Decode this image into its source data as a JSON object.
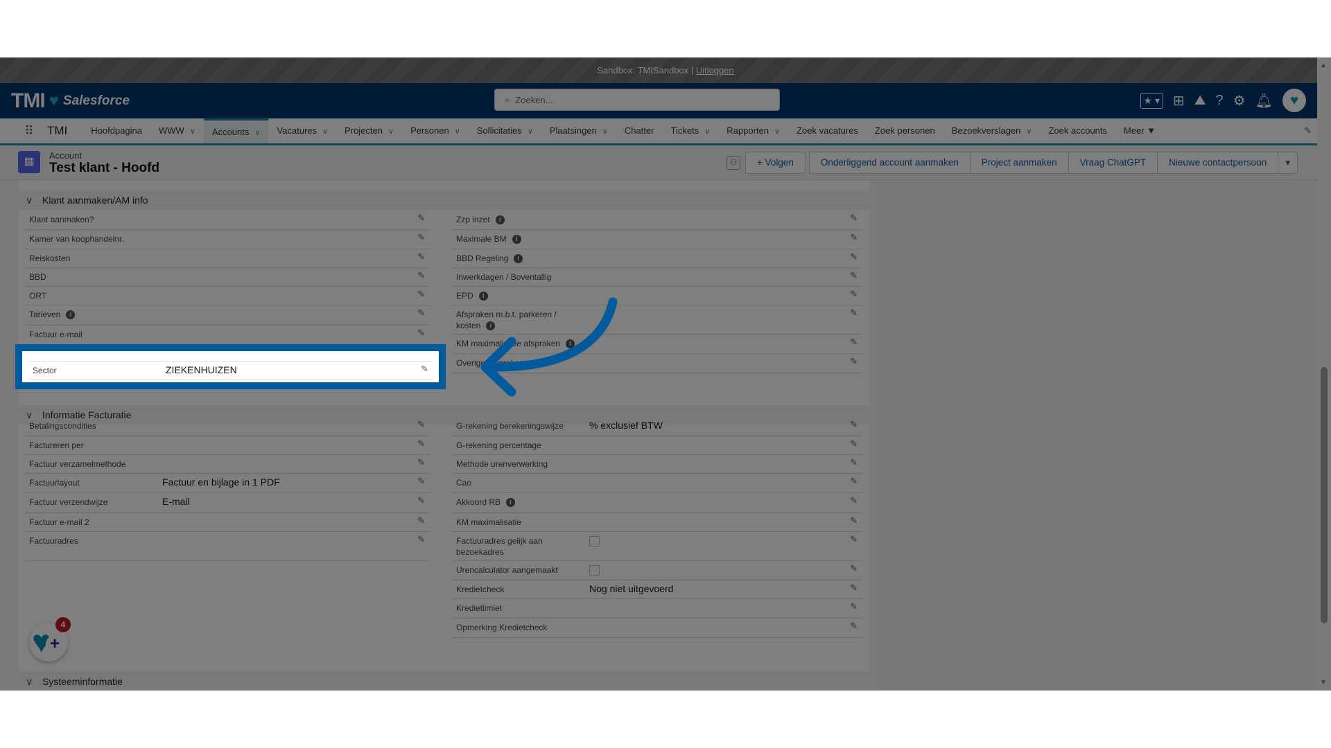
{
  "sandbox": {
    "text": "Sandbox: TMISandbox |",
    "logout": "Uitloggen"
  },
  "header": {
    "logo_text": "TMI",
    "logo_product": "Salesforce",
    "search_placeholder": "Zoeken..."
  },
  "nav": {
    "app_name": "TMI",
    "items": [
      {
        "label": "Hoofdpagina",
        "dropdown": false
      },
      {
        "label": "WWW",
        "dropdown": true
      },
      {
        "label": "Accounts",
        "dropdown": true,
        "selected": true
      },
      {
        "label": "Vacatures",
        "dropdown": true
      },
      {
        "label": "Projecten",
        "dropdown": true
      },
      {
        "label": "Personen",
        "dropdown": true
      },
      {
        "label": "Sollicitaties",
        "dropdown": true
      },
      {
        "label": "Plaatsingen",
        "dropdown": true
      },
      {
        "label": "Chatter",
        "dropdown": false
      },
      {
        "label": "Tickets",
        "dropdown": true
      },
      {
        "label": "Rapporten",
        "dropdown": true
      },
      {
        "label": "Zoek vacatures",
        "dropdown": false
      },
      {
        "label": "Zoek personen",
        "dropdown": false
      },
      {
        "label": "Bezoekverslagen",
        "dropdown": true
      },
      {
        "label": "Zoek accounts",
        "dropdown": false
      },
      {
        "label": "Meer ▼",
        "dropdown": false
      }
    ]
  },
  "record": {
    "type": "Account",
    "title": "Test klant - Hoofd",
    "follow": "Volgen",
    "actions": [
      "Onderliggend account aanmaken",
      "Project aanmaken",
      "Vraag ChatGPT",
      "Nieuwe contactpersoon"
    ]
  },
  "sections": [
    {
      "title": "Klant aanmaken/AM info",
      "left": [
        {
          "label": "Klant aanmaken?"
        },
        {
          "label": "Kamer van koophandelnr."
        },
        {
          "label": "Reiskosten"
        },
        {
          "label": "BBD"
        },
        {
          "label": "ORT"
        },
        {
          "label": "Tarieven",
          "info": true
        },
        {
          "label": "Factuur e-mail"
        }
      ],
      "right": [
        {
          "label": "Zzp inzet",
          "info": true
        },
        {
          "label": "Maximale BM",
          "info": true
        },
        {
          "label": "BBD Regeling",
          "info": true
        },
        {
          "label": "Inwerkdagen / Boventallig"
        },
        {
          "label": "EPD",
          "info": true
        },
        {
          "label": "Afspraken m.b.t. parkeren / kosten",
          "info": true,
          "tall": true
        },
        {
          "label": "KM maximalisatie afspraken",
          "info": true
        },
        {
          "label": "Overige afspraken"
        }
      ]
    },
    {
      "title": "Informatie Facturatie",
      "left": [
        {
          "label": "Betalingscondities"
        },
        {
          "label": "Factureren per"
        },
        {
          "label": "Factuur verzamelmethode"
        },
        {
          "label": "Factuurlayout",
          "value": "Factuur en bijlage in 1 PDF"
        },
        {
          "label": "Factuur verzendwijze",
          "value": "E-mail"
        },
        {
          "label": "Factuur e-mail 2"
        },
        {
          "label": "Factuuradres",
          "tall": true
        }
      ],
      "right": [
        {
          "label": "G-rekening berekeningswijze",
          "value": "% exclusief BTW"
        },
        {
          "label": "G-rekening percentage"
        },
        {
          "label": "Methode urenverwerking"
        },
        {
          "label": "Cao"
        },
        {
          "label": "Akkoord RB",
          "info": true
        },
        {
          "label": "KM maximalisatie"
        },
        {
          "label": "Factuuradres gelijk aan bezoekadres",
          "checkbox": true,
          "checked": false,
          "tall": true
        },
        {
          "label": "Urencalculator aangemaakt",
          "checkbox": true,
          "checked": false,
          "tall": true
        },
        {
          "label": "Kredietcheck",
          "value": "Nog niet uitgevoerd"
        },
        {
          "label": "Kredietlimiet"
        },
        {
          "label": "Opmerking Kredietcheck"
        }
      ]
    },
    {
      "title": "Systeeminformatie",
      "left": [],
      "right": []
    }
  ],
  "highlight": {
    "label": "Sector",
    "value": "ZIEKENHUIZEN"
  },
  "fab": {
    "badge": "4"
  },
  "colors": {
    "highlight": "#005a9c",
    "header": "#02356a",
    "accent": "#1b8fb3"
  }
}
